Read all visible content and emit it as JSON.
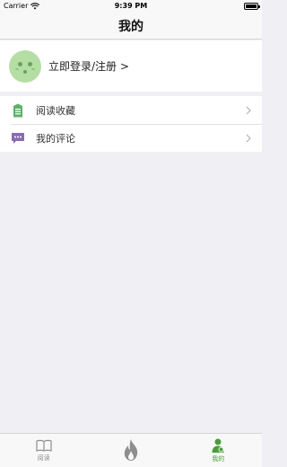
{
  "status_bar": {
    "carrier": "Carrier",
    "time": "9:39 PM"
  },
  "nav": {
    "title": "我的"
  },
  "profile": {
    "login_text": "立即登录/注册 >"
  },
  "menu": {
    "items": [
      {
        "label": "阅读收藏",
        "icon": "bookmark-icon"
      },
      {
        "label": "我的评论",
        "icon": "comment-icon"
      }
    ]
  },
  "tabs": [
    {
      "label": "阅读",
      "icon": "book-icon",
      "active": false
    },
    {
      "label": "",
      "icon": "flame-icon",
      "active": false
    },
    {
      "label": "我的",
      "icon": "user-icon",
      "active": true
    }
  ],
  "colors": {
    "accent": "#4a9d3c",
    "avatar_bg": "#b5dea5",
    "bookmark": "#5fb06a",
    "comment": "#8a6bb0"
  }
}
